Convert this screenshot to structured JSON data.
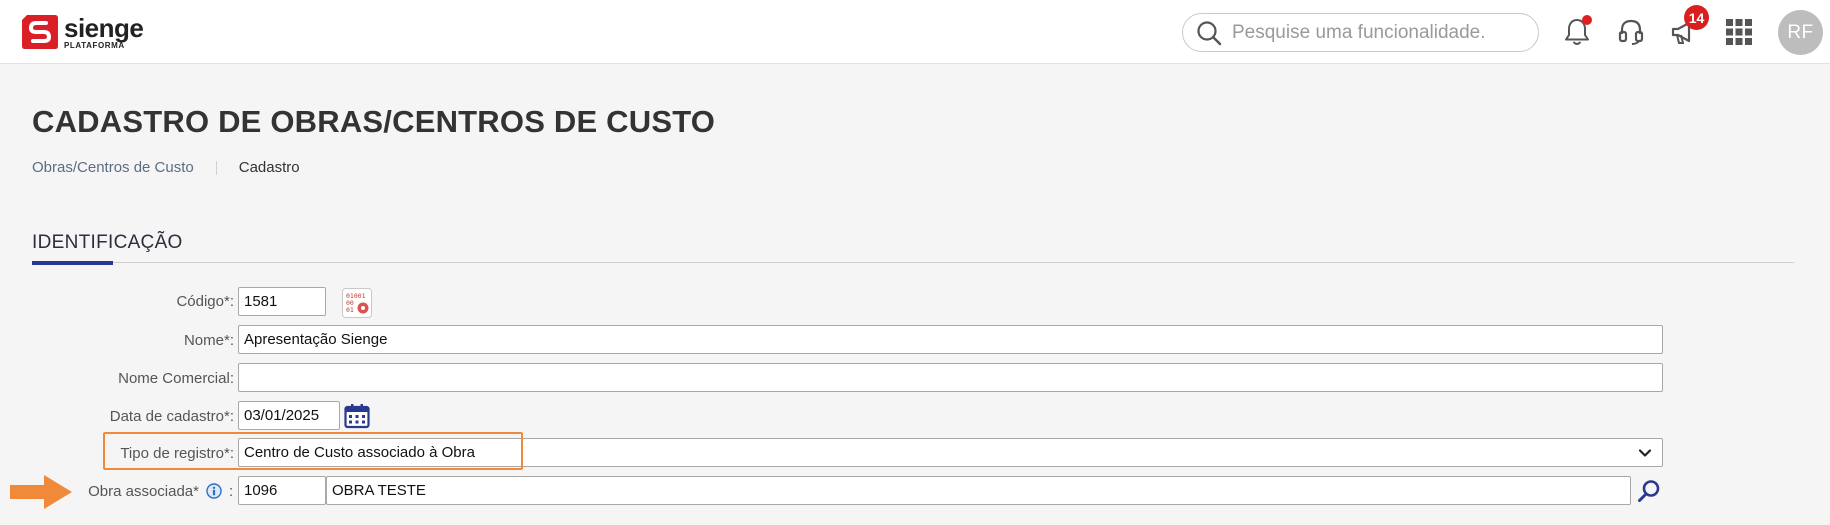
{
  "brand": {
    "name": "sienge",
    "subtitle": "PLATAFORMA",
    "color": "#d92027"
  },
  "header": {
    "search_placeholder": "Pesquise uma funcionalidade.",
    "icons": [
      "bell-icon",
      "headset-icon",
      "megaphone-icon",
      "apps-grid-icon"
    ],
    "notifications_badge": "14",
    "avatar_initials": "RF"
  },
  "page": {
    "title": "CADASTRO DE OBRAS/CENTROS DE CUSTO",
    "breadcrumb": {
      "parent": "Obras/Centros de Custo",
      "current": "Cadastro"
    }
  },
  "section": {
    "title": "IDENTIFICAÇÃO",
    "accent_color": "#2a3990"
  },
  "form": {
    "codigo": {
      "label": "Código*:",
      "value": "1581"
    },
    "nome": {
      "label": "Nome*:",
      "value": "Apresentação Sienge"
    },
    "nome_comercial": {
      "label": "Nome Comercial:",
      "value": ""
    },
    "data_cadastro": {
      "label": "Data de cadastro*:",
      "value": "03/01/2025"
    },
    "tipo_registro": {
      "label": "Tipo de registro*:",
      "value": "Centro de Custo associado à Obra"
    },
    "obra_associada": {
      "label": "Obra associada*",
      "separator": ":",
      "code": "1096",
      "name": "OBRA TESTE"
    }
  },
  "annotations": {
    "highlight_color": "#f08a3a"
  }
}
